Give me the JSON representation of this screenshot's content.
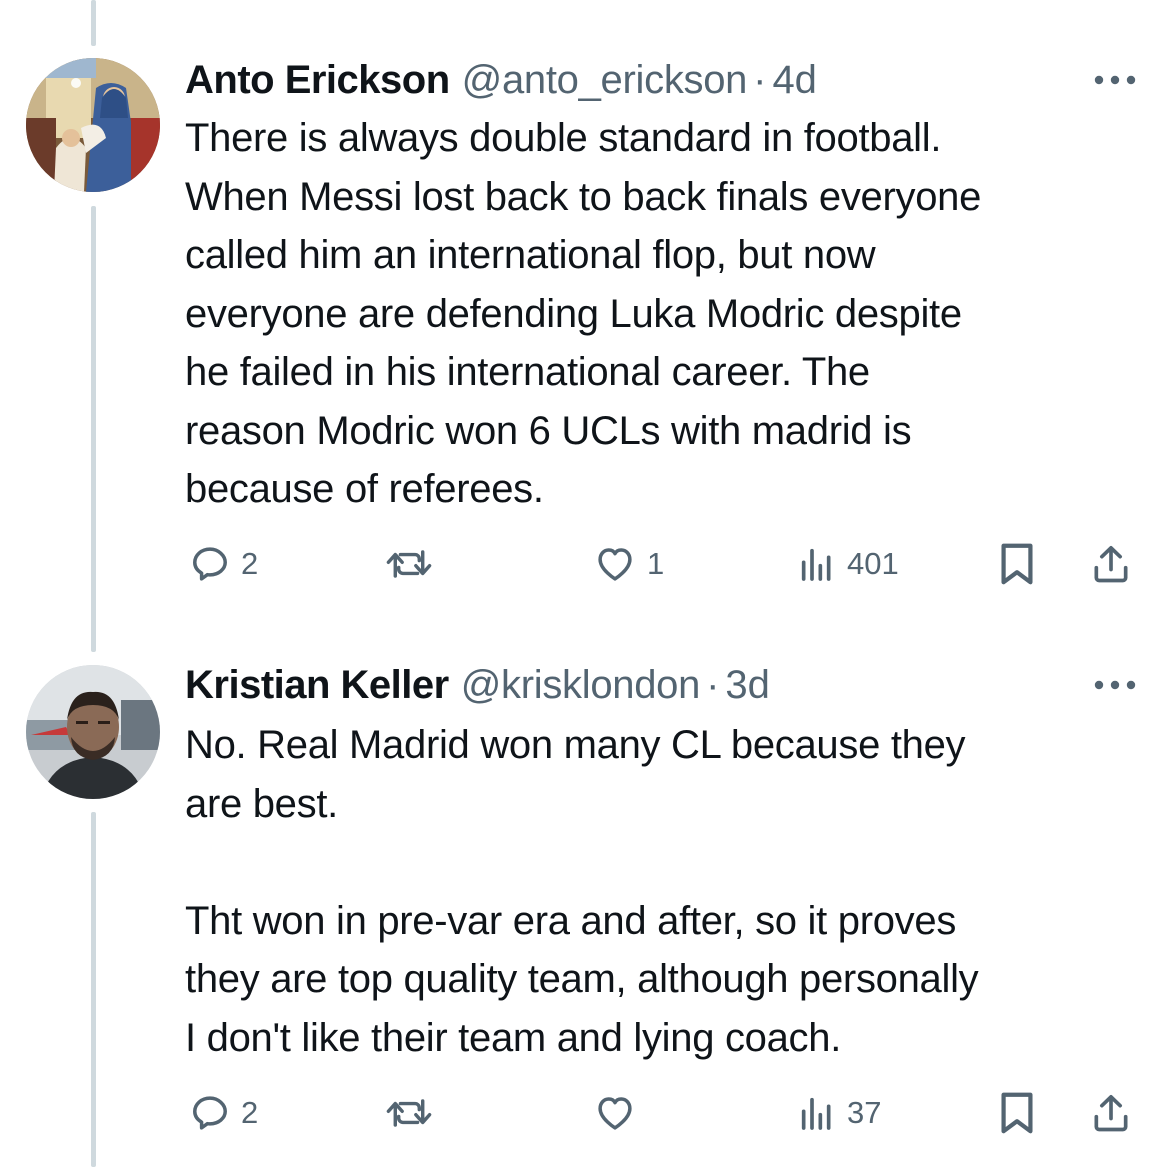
{
  "tweets": [
    {
      "name": "Anto Erickson",
      "handle": "@anto_erickson",
      "separator": "·",
      "time": "4d",
      "text": "There is always double standard in football.\nWhen Messi lost back to back finals everyone\ncalled him an international flop, but now\neveryone are defending Luka Modric despite\nhe failed in his international career. The\nreason Modric won 6 UCLs with madrid is\nbecause of referees.",
      "replies": "2",
      "retweets": "",
      "likes": "1",
      "views": "401"
    },
    {
      "name": "Kristian Keller",
      "handle": "@krisklondon",
      "separator": "·",
      "time": "3d",
      "text": "No. Real Madrid won many CL because they\nare best.\n\nTht won in pre-var era and after, so it proves\nthey are top quality team, although personally\nI don't like their team and lying coach.",
      "replies": "2",
      "retweets": "",
      "likes": "",
      "views": "37"
    }
  ],
  "icons": {
    "reply": "reply-icon",
    "retweet": "retweet-icon",
    "like": "heart-icon",
    "views": "views-icon",
    "bookmark": "bookmark-icon",
    "share": "share-icon",
    "more": "more-icon"
  },
  "colors": {
    "text": "#0f1419",
    "secondary": "#536471",
    "thread_line": "#cfd9de"
  }
}
